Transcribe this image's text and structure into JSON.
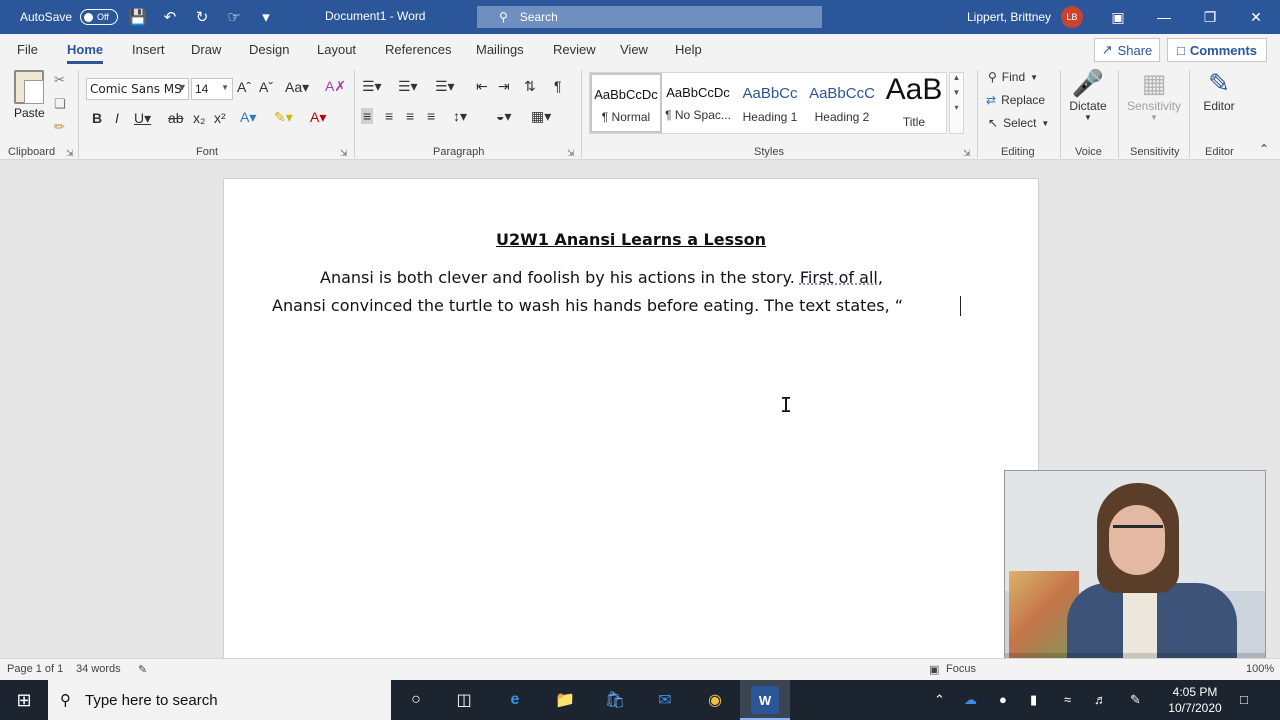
{
  "titlebar": {
    "autosave_label": "AutoSave",
    "autosave_state": "Off",
    "doc_title": "Document1  -  Word",
    "search_placeholder": "Search",
    "user_name": "Lippert, Brittney",
    "user_initials": "LB"
  },
  "tabs": [
    "File",
    "Home",
    "Insert",
    "Draw",
    "Design",
    "Layout",
    "References",
    "Mailings",
    "Review",
    "View",
    "Help"
  ],
  "active_tab": "Home",
  "share_label": "Share",
  "comments_label": "Comments",
  "ribbon": {
    "clipboard": {
      "paste_label": "Paste",
      "group_label": "Clipboard"
    },
    "font": {
      "name": "Comic Sans MS",
      "size": "14",
      "group_label": "Font"
    },
    "paragraph": {
      "group_label": "Paragraph"
    },
    "styles": {
      "group_label": "Styles",
      "items": [
        {
          "preview": "AaBbCcDc",
          "name": "¶ Normal"
        },
        {
          "preview": "AaBbCcDc",
          "name": "¶ No Spac..."
        },
        {
          "preview": "AaBbCc",
          "name": "Heading 1"
        },
        {
          "preview": "AaBbCcC",
          "name": "Heading 2"
        },
        {
          "preview": "AaB",
          "name": "Title"
        }
      ]
    },
    "editing": {
      "find": "Find",
      "replace": "Replace",
      "select": "Select",
      "group_label": "Editing"
    },
    "voice": {
      "dictate": "Dictate",
      "group_label": "Voice"
    },
    "sensitivity": {
      "label": "Sensitivity",
      "group_label": "Sensitivity"
    },
    "editor": {
      "label": "Editor",
      "group_label": "Editor"
    }
  },
  "document": {
    "title": "U2W1  Anansi Learns a Lesson",
    "line1_a": "Anansi is both clever and foolish by his actions in the story. ",
    "line1_b": "First of all",
    "line1_c": ",",
    "line2": "Anansi convinced the turtle to wash his hands before eating. The text states, “"
  },
  "statusbar": {
    "page": "Page 1 of 1",
    "words": "34 words",
    "focus": "Focus",
    "zoom": "100%"
  },
  "taskbar": {
    "search_placeholder": "Type here to search",
    "time": "4:05 PM",
    "date": "10/7/2020"
  }
}
